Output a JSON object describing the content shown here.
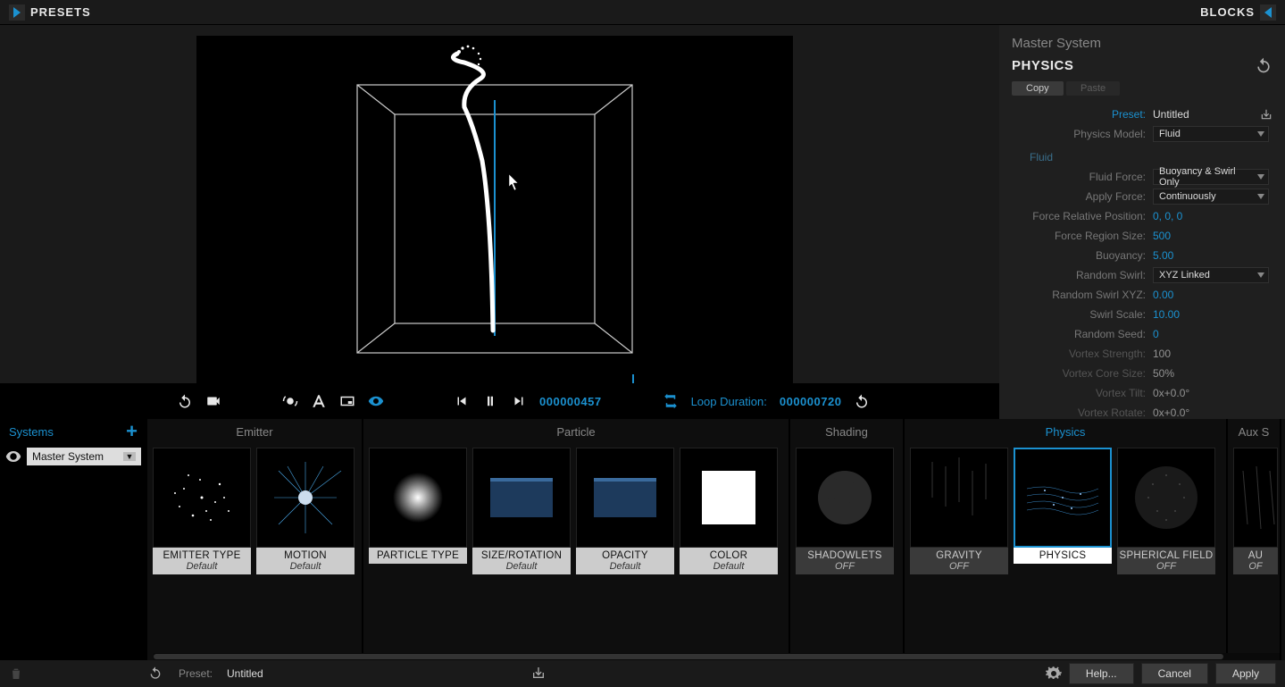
{
  "topbar": {
    "presets": "PRESETS",
    "blocks": "BLOCKS"
  },
  "props": {
    "breadcrumb": "Master System",
    "title": "PHYSICS",
    "copy": "Copy",
    "paste": "Paste",
    "rows": {
      "preset_lbl": "Preset:",
      "preset_val": "Untitled",
      "model_lbl": "Physics Model:",
      "model_val": "Fluid",
      "fluid_hdr": "Fluid",
      "force_lbl": "Fluid Force:",
      "force_val": "Buoyancy & Swirl Only",
      "apply_lbl": "Apply Force:",
      "apply_val": "Continuously",
      "relpos_lbl": "Force Relative Position:",
      "relpos_val": "0, 0, 0",
      "region_lbl": "Force Region Size:",
      "region_val": "500",
      "buoy_lbl": "Buoyancy:",
      "buoy_val": "5.00",
      "rswirl_lbl": "Random Swirl:",
      "rswirl_val": "XYZ Linked",
      "rswirlxyz_lbl": "Random Swirl XYZ:",
      "rswirlxyz_val": "0.00",
      "sscale_lbl": "Swirl Scale:",
      "sscale_val": "10.00",
      "rseed_lbl": "Random Seed:",
      "rseed_val": "0",
      "vstren_lbl": "Vortex Strength:",
      "vstren_val": "100",
      "vcore_lbl": "Vortex Core Size:",
      "vcore_val": "50%",
      "vtilt_lbl": "Vortex Tilt:",
      "vtilt_val": "0x+0.0°",
      "vrot_lbl": "Vortex Rotate:",
      "vrot_val": "0x+0.0°"
    }
  },
  "transport": {
    "timecode": "000000457",
    "loop_label": "Loop Duration:",
    "loop_value": "000000720"
  },
  "strip": {
    "systems_label": "Systems",
    "system_selected": "Master System",
    "cats": {
      "emitter": "Emitter",
      "particle": "Particle",
      "shading": "Shading",
      "physics": "Physics",
      "aux": "Aux S"
    },
    "blocks": {
      "emitter_type": {
        "t1": "EMITTER TYPE",
        "t2": "Default"
      },
      "motion": {
        "t1": "MOTION",
        "t2": "Default"
      },
      "particle_type": {
        "t1": "PARTICLE TYPE",
        "t2": ""
      },
      "size_rotation": {
        "t1": "SIZE/ROTATION",
        "t2": "Default"
      },
      "opacity": {
        "t1": "OPACITY",
        "t2": "Default"
      },
      "color": {
        "t1": "COLOR",
        "t2": "Default"
      },
      "shadowlets": {
        "t1": "SHADOWLETS",
        "t2": "OFF"
      },
      "gravity": {
        "t1": "GRAVITY",
        "t2": "OFF"
      },
      "physics": {
        "t1": "PHYSICS",
        "t2": ""
      },
      "spherical": {
        "t1": "SPHERICAL FIELD",
        "t2": "OFF"
      },
      "aux": {
        "t1": "AU",
        "t2": "OF"
      }
    }
  },
  "footer": {
    "preset_label": "Preset:",
    "preset_value": "Untitled",
    "help": "Help...",
    "cancel": "Cancel",
    "apply": "Apply"
  }
}
